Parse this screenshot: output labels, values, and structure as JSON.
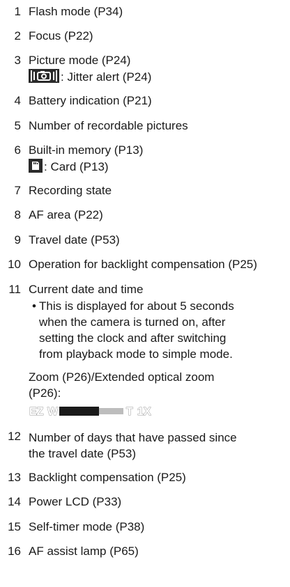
{
  "items": [
    {
      "num": "1",
      "text": "Flash mode (P34)"
    },
    {
      "num": "2",
      "text": "Focus (P22)"
    },
    {
      "num": "3",
      "text": "Picture mode (P24)",
      "sub": ": Jitter alert (P24)"
    },
    {
      "num": "4",
      "text": "Battery indication (P21)"
    },
    {
      "num": "5",
      "text": "Number of recordable pictures"
    },
    {
      "num": "6",
      "text": "Built-in memory (P13)",
      "sub": ": Card (P13)"
    },
    {
      "num": "7",
      "text": "Recording state"
    },
    {
      "num": "8",
      "text": "AF area (P22)"
    },
    {
      "num": "9",
      "text": "Travel date (P53)"
    },
    {
      "num": "10",
      "text": "Operation for backlight compensation (P25)"
    },
    {
      "num": "11",
      "text": "Current date and time"
    },
    {
      "num": "12",
      "text": "Number of days that have passed since",
      "text2": "the travel date (P53)"
    },
    {
      "num": "13",
      "text": "Backlight compensation (P25)"
    },
    {
      "num": "14",
      "text": "Power LCD (P33)"
    },
    {
      "num": "15",
      "text": "Self-timer mode (P38)"
    },
    {
      "num": "16",
      "text": "AF assist lamp (P65)"
    }
  ],
  "note": {
    "bullet": "•",
    "lines": [
      "This is displayed for about 5 seconds",
      "when the camera is turned on, after",
      "setting the clock and after switching",
      "from playback mode to simple mode."
    ]
  },
  "zoom": {
    "line1": "Zoom (P26)/Extended optical zoom",
    "line2": "(P26):",
    "ez_label": "EZ",
    "w_label": "W",
    "t_label": "T",
    "zoom_value": "1X",
    "fill_fraction": 0.62
  },
  "icons": {
    "jitter": "jitter-alert-icon",
    "card": "card-icon"
  }
}
